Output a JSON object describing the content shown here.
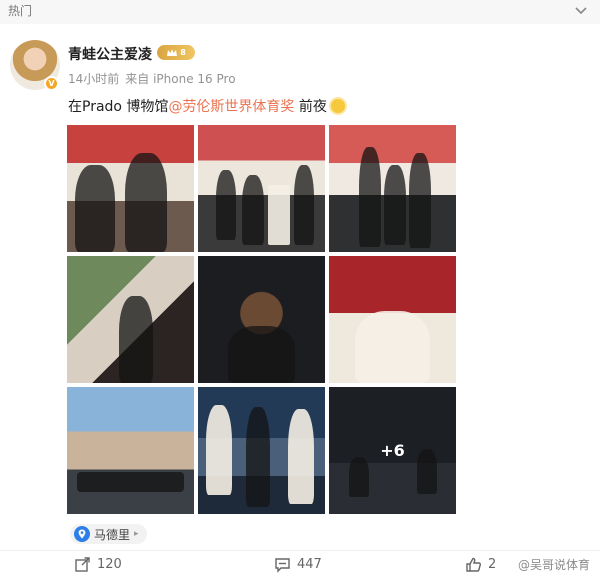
{
  "topbar": {
    "label": "热门",
    "collapse_icon": "chevron-down-icon"
  },
  "post": {
    "username": "青蛙公主爱凌",
    "verified_icon": "v-badge-icon",
    "member_icon": "crown-icon",
    "member_level": "8",
    "time": "14小时前",
    "source": "来自 iPhone 16 Pro",
    "text_prefix": "在Prado 博物馆",
    "mention": "@劳伦斯世界体育奖",
    "text_suffix": " 前夜",
    "emoji": "sun-emoji",
    "more_photos": "+6",
    "location": "马德里"
  },
  "actions": {
    "share_count": "120",
    "comment_count": "447",
    "like_count": "2"
  },
  "watermark": "@吴哥说体育",
  "colors": {
    "mention": "#eb7350",
    "meta": "#939393",
    "location_icon": "#2d7ee8"
  }
}
